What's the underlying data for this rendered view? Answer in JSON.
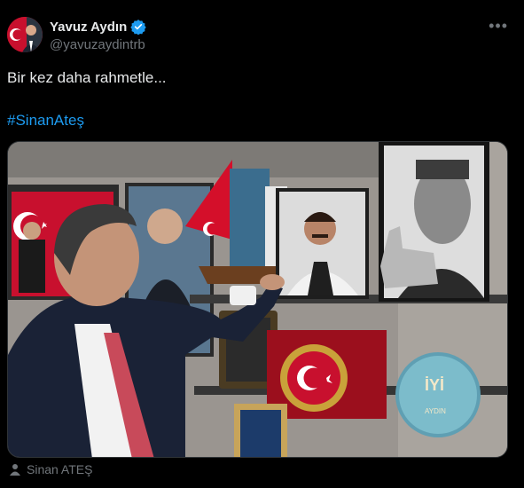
{
  "tweet": {
    "display_name": "Yavuz Aydın",
    "handle": "@yavuzaydintrb",
    "text": "Bir kez daha rahmetle...",
    "hashtag": "#SinanAteş",
    "more_icon": "more-horizontal-icon",
    "verified_icon": "verified-badge-icon"
  },
  "media": {
    "tagged_person": "Sinan ATEŞ",
    "tag_icon": "person-icon",
    "plaque_text": "İYİ",
    "plaque_name": "AYDIN"
  },
  "colors": {
    "link": "#1d9bf0",
    "muted": "#71767b",
    "text": "#e7e9ea",
    "background": "#000000"
  }
}
